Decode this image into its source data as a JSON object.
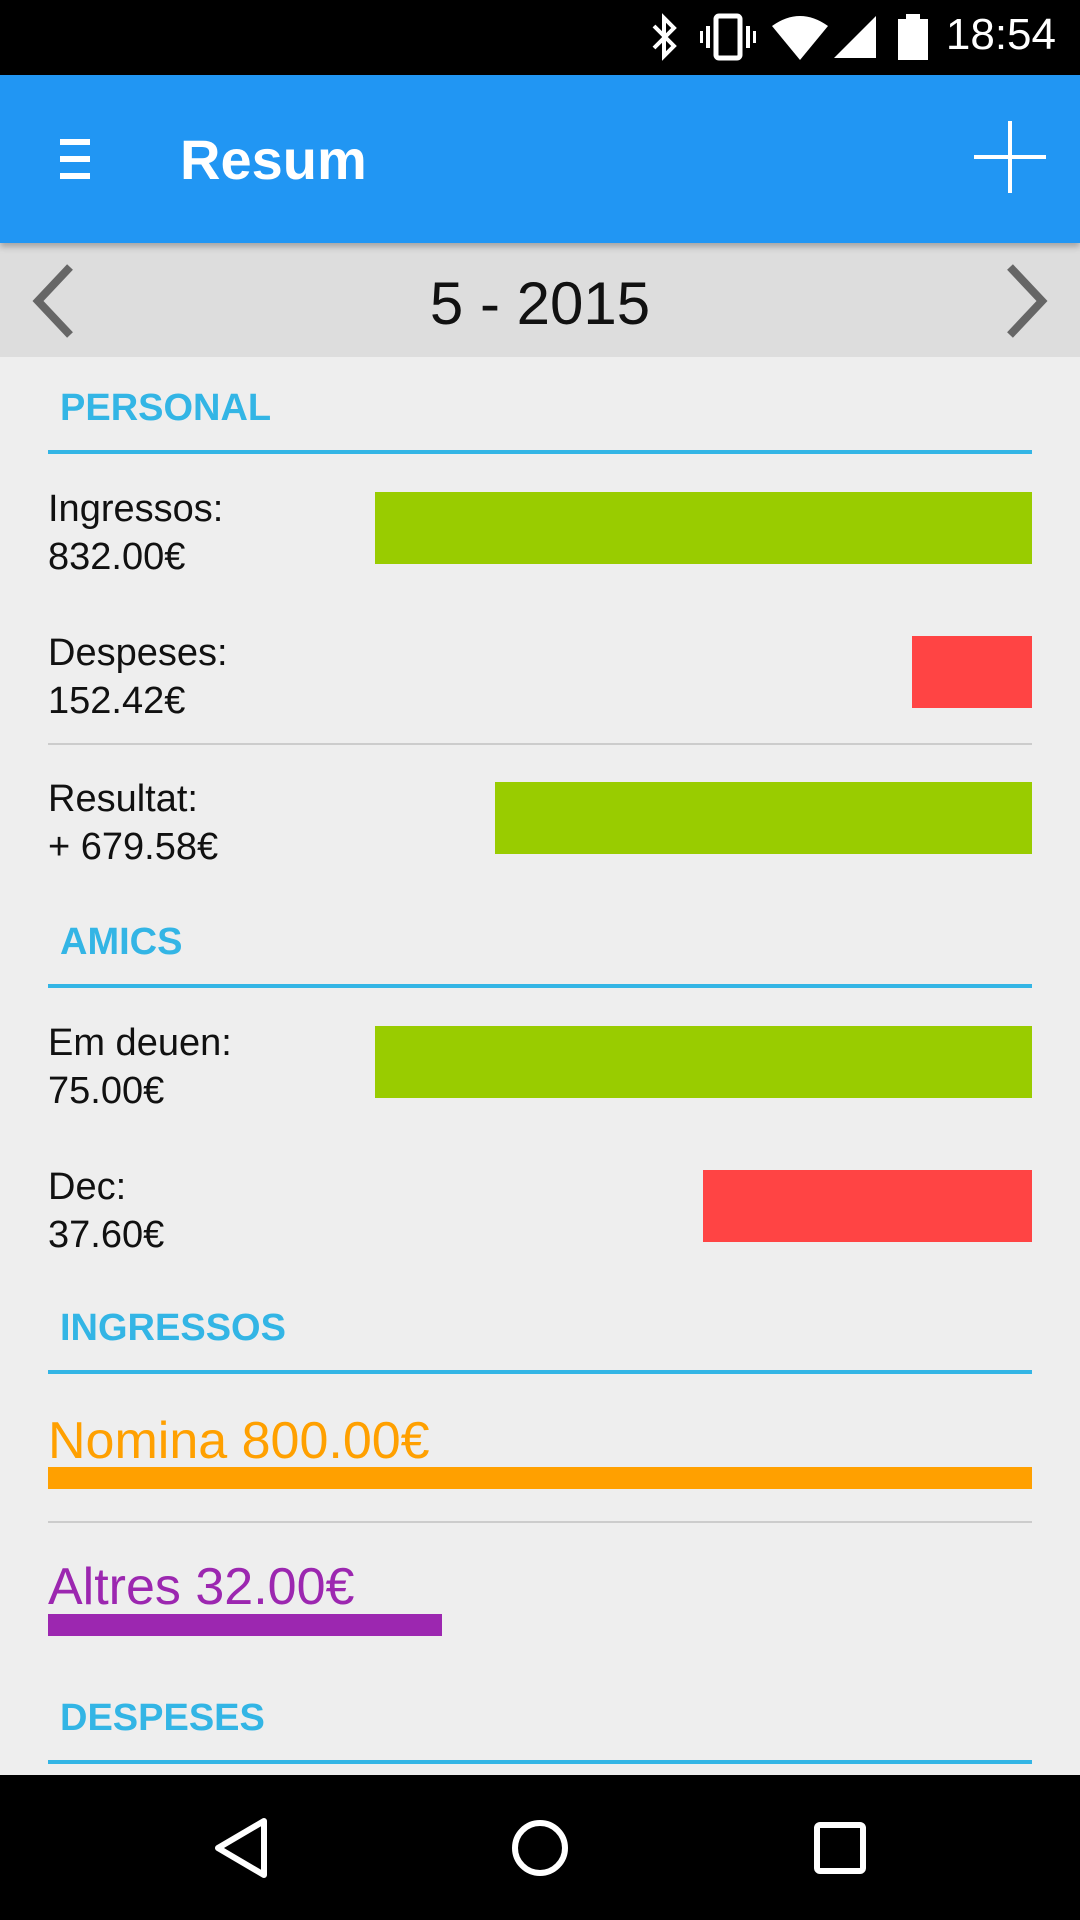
{
  "status_bar": {
    "time": "18:54",
    "icons": [
      "bluetooth-icon",
      "vibrate-icon",
      "wifi-icon",
      "signal-icon",
      "battery-icon"
    ]
  },
  "app_bar": {
    "title": "Resum",
    "menu_icon": "menu-icon",
    "add_icon": "plus-icon",
    "color": "#2196F3"
  },
  "month_nav": {
    "label": "5 - 2015"
  },
  "personal": {
    "header": "PERSONAL",
    "rows": [
      {
        "line1": "Ingressos:",
        "line2": "832.00€",
        "fraction": 1.0,
        "status": "positive"
      },
      {
        "line1": "Despeses:",
        "line2": "152.42€",
        "fraction": 0.183,
        "status": "negative"
      },
      {
        "line1": "Resultat:",
        "line2": "+ 679.58€",
        "fraction": 0.817,
        "status": "positive"
      }
    ]
  },
  "amics": {
    "header": "AMICS",
    "rows": [
      {
        "line1": "Em deuen:",
        "line2": "75.00€",
        "fraction": 1.0,
        "status": "positive"
      },
      {
        "line1": "Dec:",
        "line2": "37.60€",
        "fraction": 0.501,
        "status": "negative"
      }
    ]
  },
  "ingressos": {
    "header": "INGRESSOS",
    "items": [
      {
        "label": "Nomina 800.00€",
        "fraction": 1.0,
        "color": "#FFA000"
      },
      {
        "label": "Altres 32.00€",
        "fraction": 0.4,
        "color": "#9C27B0"
      }
    ]
  },
  "despeses": {
    "header": "DESPESES"
  },
  "colors": {
    "accent": "#33B5E5",
    "positive": "#99CC00",
    "negative": "#FF4444"
  },
  "nav_bar": {
    "icons": [
      "back-icon",
      "home-icon",
      "recents-icon"
    ]
  }
}
